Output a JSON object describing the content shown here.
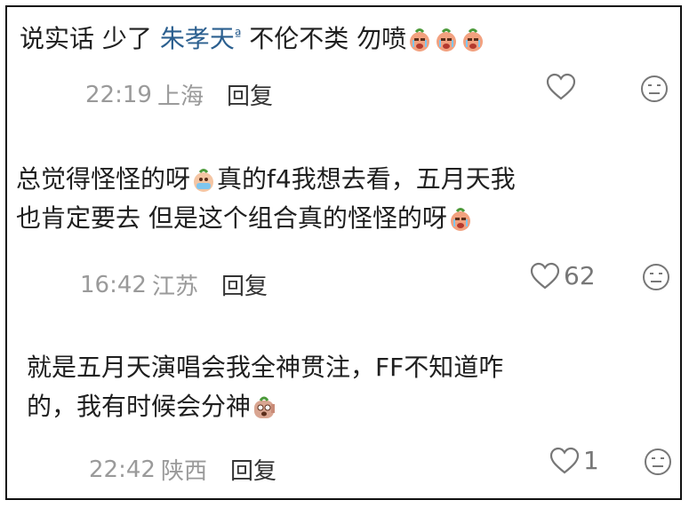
{
  "comments": [
    {
      "text_before": "说实话 少了 ",
      "mention": "朱孝天",
      "text_after": " 不伦不类 勿喷",
      "time": "22:19",
      "location": "上海",
      "reply_label": "回复",
      "likes": "",
      "emoji_icon": "crying-peach-emoji"
    },
    {
      "line1": "总觉得怪怪的呀",
      "line1b": "真的f4我想去看，五月天我",
      "line2": "也肯定要去 但是这个组合真的怪怪的呀",
      "time": "16:42",
      "location": "江苏",
      "reply_label": "回复",
      "likes": "62"
    },
    {
      "line1": "就是五月天演唱会我全神贯注，FF不知道咋",
      "line2": "的，我有时候会分神",
      "time": "22:42",
      "location": "陕西",
      "reply_label": "回复",
      "likes": "1"
    }
  ]
}
